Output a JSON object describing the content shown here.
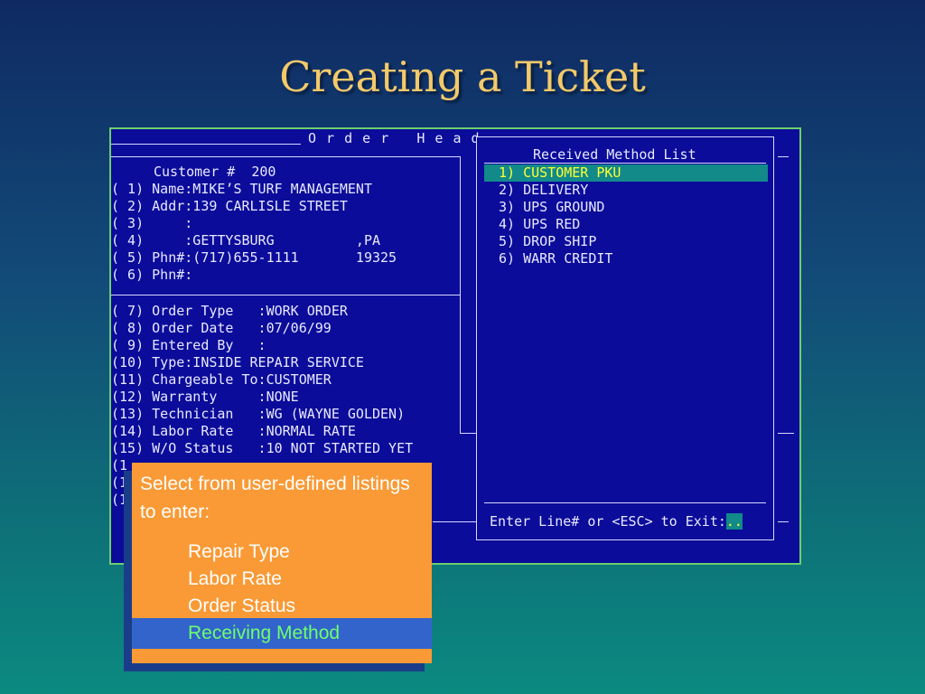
{
  "slide": {
    "title": "Creating a Ticket"
  },
  "order_header": {
    "title": "O r d e r   H e a d",
    "customer_line": "Customer #  200",
    "customer_fields": [
      "( 1) Name:MIKE’S TURF MANAGEMENT",
      "( 2) Addr:139 CARLISLE STREET",
      "( 3)     :",
      "( 4)     :GETTYSBURG          ,PA",
      "( 5) Phn#:(717)655-1111       19325",
      "( 6) Phn#:"
    ],
    "order_fields": [
      "( 7) Order Type   :WORK ORDER",
      "( 8) Order Date   :07/06/99",
      "( 9) Entered By   :",
      "(10) Type:INSIDE REPAIR SERVICE",
      "(11) Chargeable To:CUSTOMER",
      "(12) Warranty     :NONE",
      "(13) Technician   :WG (WAYNE GOLDEN)",
      "(14) Labor Rate   :NORMAL RATE",
      "(15) W/O Status   :10 NOT STARTED YET"
    ],
    "partial_rows": [
      "(1",
      "(1",
      "(1"
    ]
  },
  "popup": {
    "title": "Received Method List",
    "items": [
      "1) CUSTOMER PKU",
      "2) DELIVERY",
      "3) UPS GROUND",
      "4) UPS RED",
      "5) DROP SHIP",
      "6) WARR CREDIT"
    ],
    "selected_index": 0,
    "prompt": "Enter Line# or <ESC> to Exit:",
    "cursor": ".."
  },
  "callout": {
    "intro": "Select from user-defined listings to enter:",
    "items": [
      "Repair Type",
      "Labor Rate",
      "Order Status",
      "Receiving Method"
    ],
    "highlighted_index": 3,
    "colors": {
      "box": "#f99a36",
      "highlight_bar": "#3264cc",
      "highlight_text": "#6dff6d"
    }
  }
}
